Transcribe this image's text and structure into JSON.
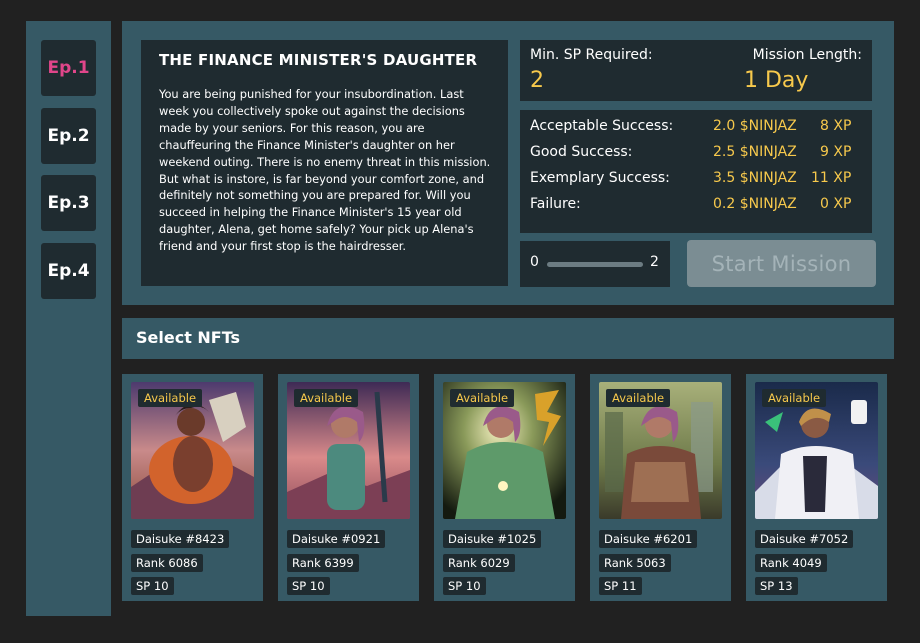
{
  "sidebar": {
    "episodes": [
      {
        "label": "Ep.1",
        "active": true
      },
      {
        "label": "Ep.2",
        "active": false
      },
      {
        "label": "Ep.3",
        "active": false
      },
      {
        "label": "Ep.4",
        "active": false
      }
    ]
  },
  "mission": {
    "title": "THE FINANCE MINISTER'S DAUGHTER",
    "description": "You are being punished for your insubordination. Last week you collectively spoke out against the decisions made by your seniors. For this reason, you are chauffeuring the Finance Minister's daughter on her weekend outing. There is no enemy threat in this mission. But what is instore, is far beyond your comfort zone, and definitely not something you are prepared for. Will you succeed in helping the Finance Minister's 15 year old daughter, Alena, get home safely? Your pick up Alena's friend and your first stop is the hairdresser.",
    "min_sp_label": "Min. SP Required:",
    "min_sp_value": "2",
    "length_label": "Mission Length:",
    "length_value": "1 Day",
    "rewards": [
      {
        "label": "Acceptable Success:",
        "ninjaz": "2.0 $NINJAZ",
        "xp": "8 XP"
      },
      {
        "label": "Good Success:",
        "ninjaz": "2.5 $NINJAZ",
        "xp": "9 XP"
      },
      {
        "label": "Exemplary Success:",
        "ninjaz": "3.5 $NINJAZ",
        "xp": "11 XP"
      },
      {
        "label": "Failure:",
        "ninjaz": "0.2 $NINJAZ",
        "xp": "0 XP"
      }
    ],
    "slider_min": "0",
    "slider_max": "2",
    "start_label": "Start Mission"
  },
  "select_title": "Select NFTs",
  "nfts": [
    {
      "status": "Available",
      "name": "Daisuke #8423",
      "rank": "Rank 6086",
      "sp": "SP 10"
    },
    {
      "status": "Available",
      "name": "Daisuke #0921",
      "rank": "Rank 6399",
      "sp": "SP 10"
    },
    {
      "status": "Available",
      "name": "Daisuke #1025",
      "rank": "Rank 6029",
      "sp": "SP 10"
    },
    {
      "status": "Available",
      "name": "Daisuke #6201",
      "rank": "Rank 5063",
      "sp": "SP 11"
    },
    {
      "status": "Available",
      "name": "Daisuke #7052",
      "rank": "Rank 4049",
      "sp": "SP 13"
    }
  ],
  "colors": {
    "background": "#212121",
    "panel": "#365965",
    "dark_box": "#1f2b30",
    "accent_gold": "#f7c94c",
    "accent_pink": "#e0468a",
    "disabled_button": "#7b8d93"
  }
}
